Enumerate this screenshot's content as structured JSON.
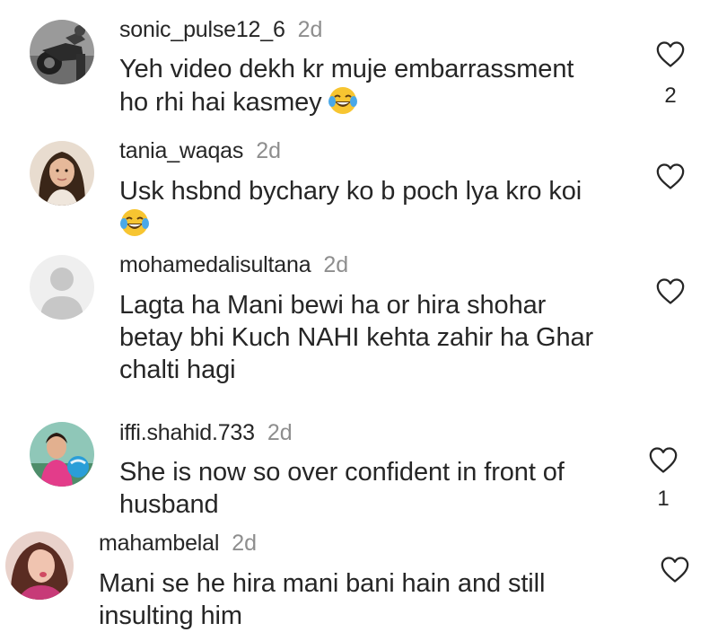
{
  "comments": [
    {
      "username": "sonic_pulse12_6",
      "time": "2d",
      "lines": [
        "Yeh video dekh kr muje embarrassment",
        "ho rhi hai kasmey"
      ],
      "emoji": "laughing-tears-emoji",
      "likes": "2",
      "avatar": "motorcycle-avatar"
    },
    {
      "username": "tania_waqas",
      "time": "2d",
      "lines": [
        "Usk hsbnd bychary ko b poch lya kro koi"
      ],
      "emoji": "laughing-tears-emoji",
      "likes": "",
      "avatar": "woman-portrait-avatar"
    },
    {
      "username": "mohamedalisultana",
      "time": "2d",
      "lines": [
        "Lagta ha Mani bewi ha or hira shohar",
        "betay bhi Kuch NAHI kehta zahir ha Ghar",
        "chalti hagi"
      ],
      "emoji": "",
      "likes": "",
      "avatar": "default-user-avatar"
    },
    {
      "username": "iffi.shahid.733",
      "time": "2d",
      "lines": [
        "She is now so over confident in front of",
        "husband"
      ],
      "emoji": "",
      "likes": "1",
      "avatar": "child-portrait-avatar"
    },
    {
      "username": "mahambelal",
      "time": "2d",
      "lines": [
        "Mani se he hira mani bani hain and still",
        "insulting him"
      ],
      "emoji": "",
      "likes": "",
      "avatar": "woman-selfie-avatar"
    }
  ],
  "colors": {
    "text": "#262626",
    "secondary": "#8e8e8e",
    "background": "#ffffff"
  },
  "icons": {
    "like": "heart-outline-icon"
  }
}
